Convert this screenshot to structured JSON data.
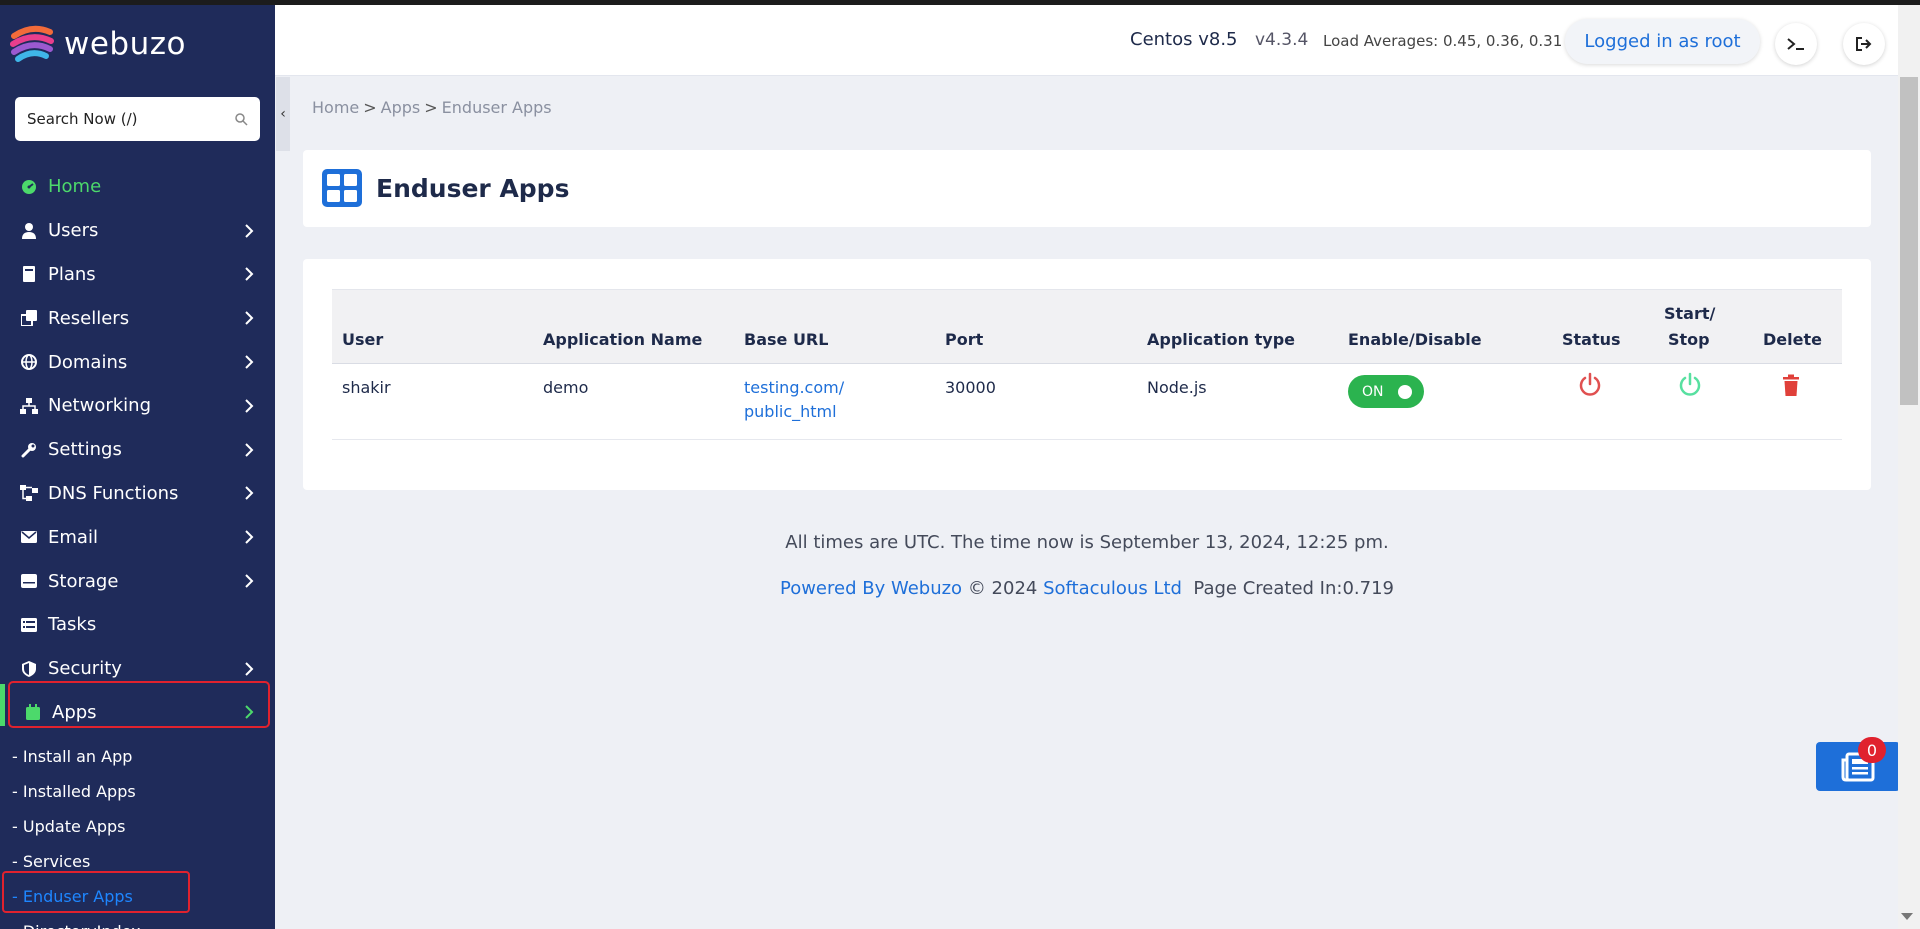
{
  "brand": {
    "name": "webuzo"
  },
  "search": {
    "placeholder": "Search Now (/)"
  },
  "nav": {
    "items": [
      {
        "label": "Home"
      },
      {
        "label": "Users"
      },
      {
        "label": "Plans"
      },
      {
        "label": "Resellers"
      },
      {
        "label": "Domains"
      },
      {
        "label": "Networking"
      },
      {
        "label": "Settings"
      },
      {
        "label": "DNS Functions"
      },
      {
        "label": "Email"
      },
      {
        "label": "Storage"
      },
      {
        "label": "Tasks"
      },
      {
        "label": "Security"
      },
      {
        "label": "Apps"
      }
    ],
    "apps_sub": [
      {
        "label": "- Install an App"
      },
      {
        "label": "- Installed Apps"
      },
      {
        "label": "- Update Apps"
      },
      {
        "label": "- Services"
      },
      {
        "label": "- Enduser Apps"
      },
      {
        "label": "- DirectoryIndex"
      }
    ]
  },
  "header": {
    "os": "Centos v8.5",
    "version": "v4.3.4",
    "load": "Load Averages: 0.45, 0.36, 0.31",
    "login": "Logged in as root"
  },
  "breadcrumb": {
    "home": "Home",
    "sep": ">",
    "apps": "Apps",
    "current": "Enduser Apps"
  },
  "page": {
    "title": "Enduser Apps"
  },
  "table": {
    "headers": [
      "User",
      "Application Name",
      "Base URL",
      "Port",
      "Application type",
      "Enable/Disable",
      "Status",
      "Start/",
      "Stop",
      "Delete"
    ],
    "rows": [
      {
        "user": "shakir",
        "app": "demo",
        "url1": "testing.com/",
        "url2": "public_html",
        "port": "30000",
        "type": "Node.js",
        "toggle": "ON"
      }
    ]
  },
  "footer": {
    "time": "All times are UTC. The time now is September 13, 2024, 12:25 pm.",
    "powered": "Powered By Webuzo",
    "copy": "© 2024",
    "company": "Softaculous Ltd",
    "created": "Page Created In:0.719"
  },
  "float": {
    "badge": "0"
  },
  "colors": {
    "sidebar": "#1f2b5a",
    "accent": "#1e6fd9",
    "home_green": "#4cd96b",
    "danger": "#e0222e",
    "on_green": "#2bb34f",
    "start_green": "#57e0a0"
  }
}
